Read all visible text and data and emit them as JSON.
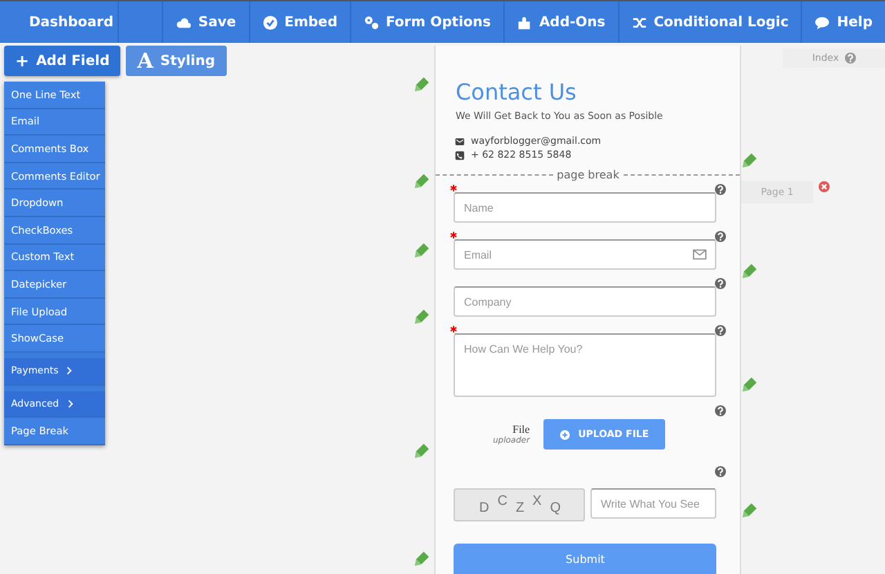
{
  "topbar": {
    "back": "Dashboard",
    "actions": [
      {
        "label": "Save"
      },
      {
        "label": "Embed"
      },
      {
        "label": "Form Options"
      },
      {
        "label": "Add-Ons"
      },
      {
        "label": "Conditional Logic"
      },
      {
        "label": "Help"
      }
    ]
  },
  "toolbar": {
    "tabs": [
      {
        "label": "Add Field",
        "glyph": "+",
        "selected": true
      },
      {
        "label": "Styling",
        "glyph": "A",
        "selected": false
      }
    ]
  },
  "field_menu": [
    {
      "label": "One Line Text",
      "submenu": false
    },
    {
      "label": "Email",
      "submenu": false
    },
    {
      "label": "Comments Box",
      "submenu": false
    },
    {
      "label": "Comments Editor",
      "submenu": false
    },
    {
      "label": "Dropdown",
      "submenu": false
    },
    {
      "label": "CheckBoxes",
      "submenu": false
    },
    {
      "label": "Custom Text",
      "submenu": false
    },
    {
      "label": "Datepicker",
      "submenu": false
    },
    {
      "label": "File Upload",
      "submenu": false
    },
    {
      "label": "ShowCase",
      "submenu": false
    },
    {
      "label": "Payments",
      "submenu": true
    },
    {
      "label": "Advanced",
      "submenu": true
    },
    {
      "label": "Page Break",
      "submenu": false
    }
  ],
  "form": {
    "title": "Contact Us",
    "subtitle": "We Will Get Back to You as Soon as Posible",
    "contacts": [
      {
        "kind": "email",
        "text": "wayforblogger@gmail.com"
      },
      {
        "kind": "phone",
        "text": "+ 62 822 8515 5848"
      }
    ],
    "page_break": "page break",
    "fields": [
      {
        "kind": "input",
        "placeholder": "Name",
        "required": true,
        "icon": false
      },
      {
        "kind": "input",
        "placeholder": "Email",
        "required": true,
        "icon": true
      },
      {
        "kind": "input",
        "placeholder": "Company",
        "icon": false
      },
      {
        "kind": "textarea",
        "placeholder": "How Can We Help You?",
        "required": true
      },
      {
        "kind": "file",
        "label": "File",
        "sublabel": "uploader",
        "button": "UPLOAD FILE"
      },
      {
        "kind": "captcha",
        "letters": [
          "D",
          "C",
          "Z",
          "X",
          "Q"
        ],
        "placeholder": "Write What You See"
      }
    ],
    "submit": "Submit"
  },
  "pages_panel": {
    "index": "Index",
    "pages": [
      {
        "label": "Page 1"
      }
    ]
  }
}
